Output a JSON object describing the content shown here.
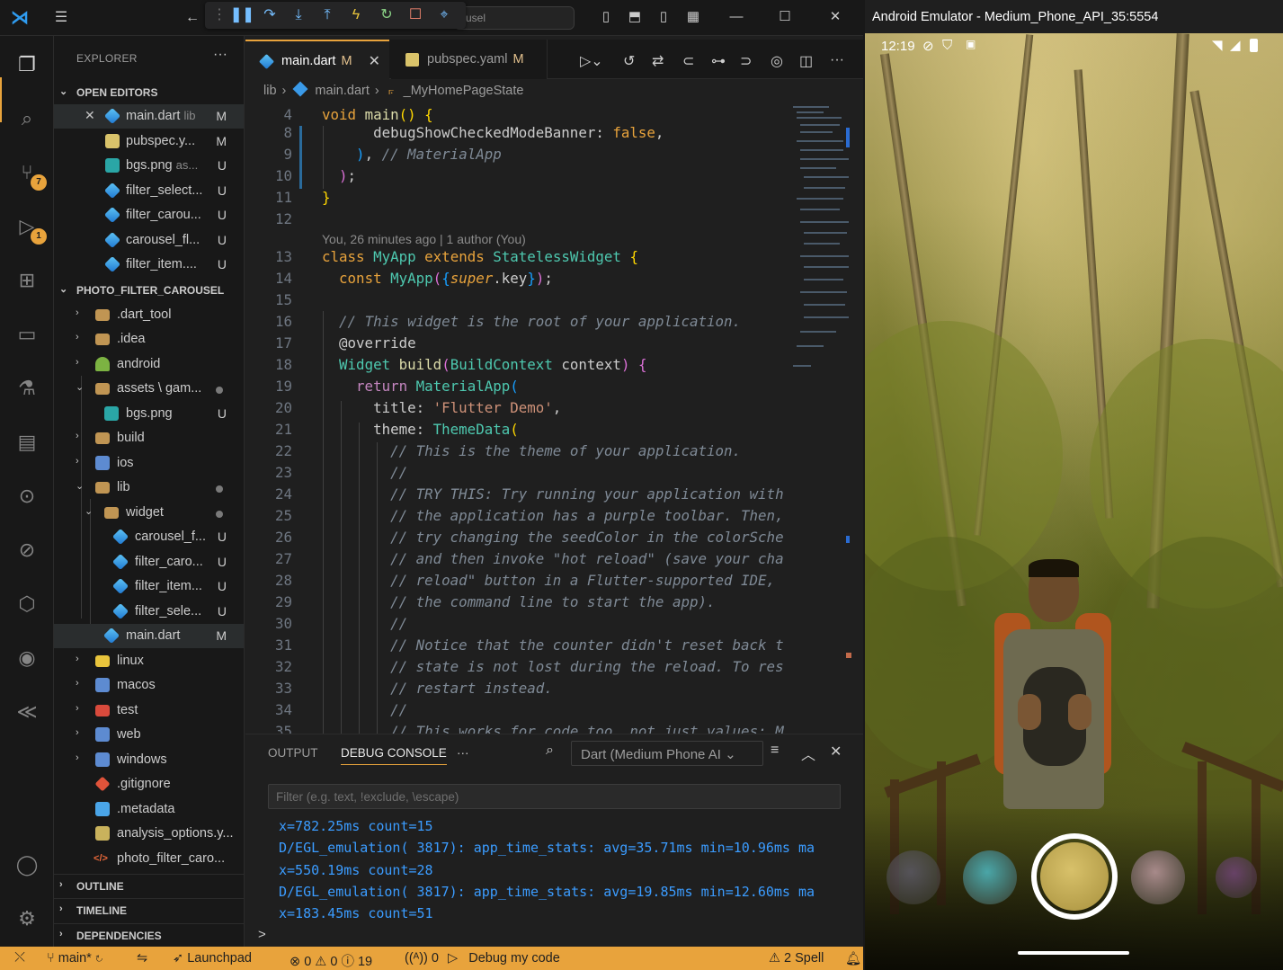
{
  "titlebar": {
    "command_center": "usel"
  },
  "explorer": {
    "title": "EXPLORER",
    "open_editors_label": "OPEN EDITORS",
    "open_editors": [
      {
        "name": "main.dart",
        "desc": "lib",
        "status": "M",
        "icon": "dart"
      },
      {
        "name": "pubspec.y...",
        "desc": "",
        "status": "M",
        "icon": "yaml"
      },
      {
        "name": "bgs.png",
        "desc": "as...",
        "status": "U",
        "icon": "image"
      },
      {
        "name": "filter_select...",
        "desc": "",
        "status": "U",
        "icon": "dart"
      },
      {
        "name": "filter_carou...",
        "desc": "",
        "status": "U",
        "icon": "dart"
      },
      {
        "name": "carousel_fl...",
        "desc": "",
        "status": "U",
        "icon": "dart"
      },
      {
        "name": "filter_item....",
        "desc": "",
        "status": "U",
        "icon": "dart"
      }
    ],
    "project_label": "PHOTO_FILTER_CAROUSEL",
    "tree": [
      {
        "name": ".dart_tool",
        "status": ""
      },
      {
        "name": ".idea",
        "status": ""
      },
      {
        "name": "android",
        "status": ""
      },
      {
        "name": "assets \\ gam...",
        "status": "dot"
      },
      {
        "name": "bgs.png",
        "status": "U"
      },
      {
        "name": "build",
        "status": ""
      },
      {
        "name": "ios",
        "status": ""
      },
      {
        "name": "lib",
        "status": "dot"
      },
      {
        "name": "widget",
        "status": "dot"
      },
      {
        "name": "carousel_f...",
        "status": "U"
      },
      {
        "name": "filter_caro...",
        "status": "U"
      },
      {
        "name": "filter_item...",
        "status": "U"
      },
      {
        "name": "filter_sele...",
        "status": "U"
      },
      {
        "name": "main.dart",
        "status": "M"
      },
      {
        "name": "linux",
        "status": ""
      },
      {
        "name": "macos",
        "status": ""
      },
      {
        "name": "test",
        "status": ""
      },
      {
        "name": "web",
        "status": ""
      },
      {
        "name": "windows",
        "status": ""
      },
      {
        "name": ".gitignore",
        "status": ""
      },
      {
        "name": ".metadata",
        "status": ""
      },
      {
        "name": "analysis_options.y...",
        "status": ""
      },
      {
        "name": "photo_filter_caro...",
        "status": ""
      }
    ],
    "outline_label": "OUTLINE",
    "timeline_label": "TIMELINE",
    "dependencies_label": "DEPENDENCIES"
  },
  "activity": {
    "scm_badge": "7",
    "debug_badge": "1"
  },
  "tabs": [
    {
      "name": "main.dart",
      "modified": "M"
    },
    {
      "name": "pubspec.yaml",
      "modified": "M"
    }
  ],
  "breadcrumb": [
    "lib",
    "main.dart",
    "_MyHomePageState"
  ],
  "editor": {
    "blame": "You, 26 minutes ago | 1 author (You)",
    "line_numbers": [
      "4",
      "8",
      "9",
      "10",
      "11",
      "12",
      "13",
      "14",
      "15",
      "16",
      "17",
      "18",
      "19",
      "20",
      "21",
      "22",
      "23",
      "24",
      "25",
      "26",
      "27",
      "28",
      "29",
      "30",
      "31",
      "32",
      "33",
      "34",
      "35"
    ]
  },
  "panel": {
    "tab_output": "OUTPUT",
    "tab_debug_console": "DEBUG CONSOLE",
    "more": "···",
    "dart_select": "Dart (Medium Phone AI",
    "filter_placeholder": "Filter (e.g. text, !exclude, \\escape)",
    "console_lines": [
      "x=782.25ms count=15",
      "D/EGL_emulation( 3817): app_time_stats: avg=35.71ms min=10.96ms ma",
      "x=550.19ms count=28",
      "D/EGL_emulation( 3817): app_time_stats: avg=19.85ms min=12.60ms ma",
      "x=183.45ms count=51"
    ],
    "prompt": ">"
  },
  "statusbar": {
    "branch": "main*",
    "launchpad": "Launchpad",
    "errors": "0",
    "warnings": "0",
    "info": "19",
    "ports": "0",
    "debug_label": "Debug my code",
    "spell": "2 Spell"
  },
  "emulator": {
    "title": "Android Emulator - Medium_Phone_API_35:5554",
    "time": "12:19",
    "swatch_colors": [
      "#6e6a8a",
      "#4aa6a8",
      "#c9b25c",
      "#a88a8a",
      "#8a4aa0"
    ]
  }
}
